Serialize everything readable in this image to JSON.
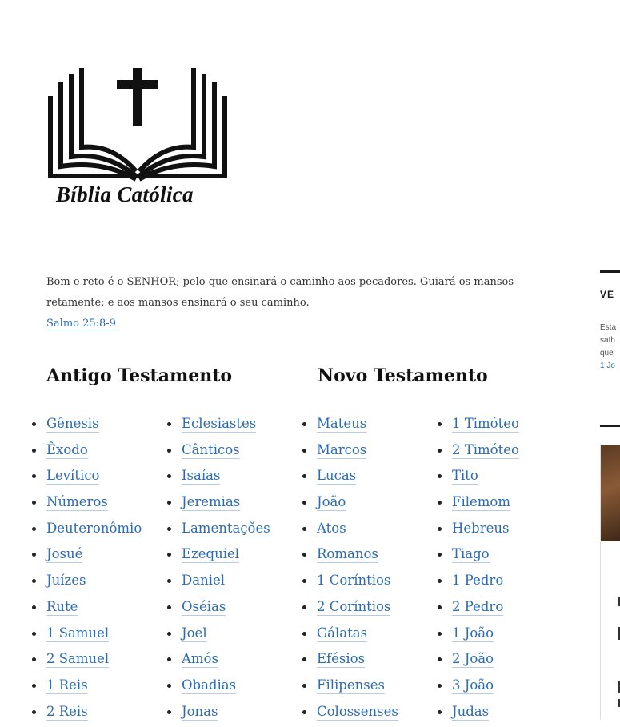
{
  "site": {
    "logo_text": "Bíblia Católica"
  },
  "verse": {
    "text": "Bom e reto é o SENHOR; pelo que ensinará o caminho aos pecadores. Guiará os mansos retamente; e aos mansos ensinará o seu caminho.",
    "reference": "Salmo 25:8-9"
  },
  "old_testament": {
    "title": "Antigo Testamento",
    "col1": [
      "Gênesis",
      "Êxodo",
      "Levítico",
      "Números",
      "Deuteronômio",
      "Josué",
      "Juízes",
      "Rute",
      "1 Samuel",
      "2 Samuel",
      "1 Reis",
      "2 Reis"
    ],
    "col2": [
      "Eclesiastes",
      "Cânticos",
      "Isaías",
      "Jeremias",
      "Lamentações",
      "Ezequiel",
      "Daniel",
      "Oséias",
      "Joel",
      "Amós",
      "Obadias",
      "Jonas"
    ]
  },
  "new_testament": {
    "title": "Novo Testamento",
    "col1": [
      "Mateus",
      "Marcos",
      "Lucas",
      "João",
      "Atos",
      "Romanos",
      "1 Coríntios",
      "2 Coríntios",
      "Gálatas",
      "Efésios",
      "Filipenses",
      "Colossenses"
    ],
    "col2": [
      "1 Timóteo",
      "2 Timóteo",
      "Tito",
      "Filemom",
      "Hebreus",
      "Tiago",
      "1 Pedro",
      "2 Pedro",
      "1 João",
      "2 João",
      "3 João",
      "Judas"
    ]
  },
  "sidebar": {
    "widget_title": "VE",
    "text_lines": [
      "Esta",
      "saíh",
      "que"
    ],
    "link": "1 Jo"
  },
  "colors": {
    "link": "#2b6cb3",
    "text": "#1a1a1a"
  }
}
